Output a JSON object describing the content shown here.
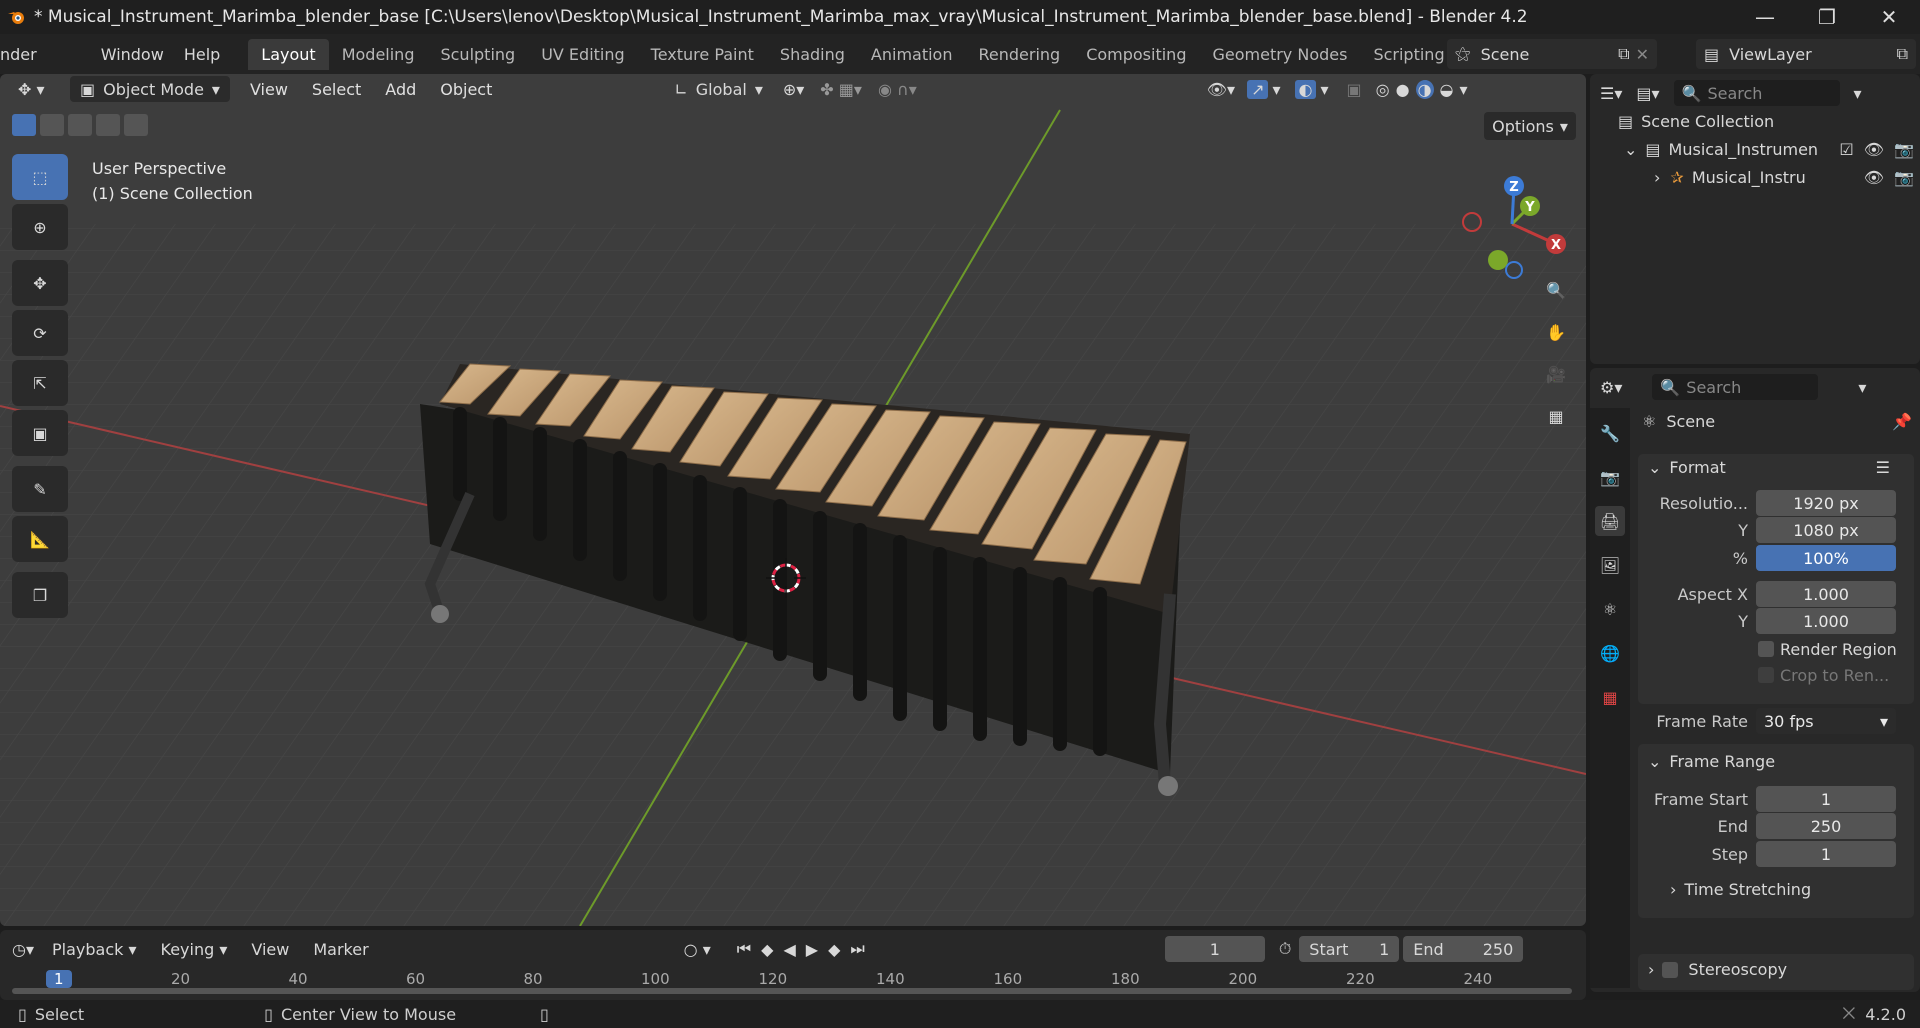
{
  "window": {
    "title": "* Musical_Instrument_Marimba_blender_base [C:\\Users\\lenov\\Desktop\\Musical_Instrument_Marimba_max_vray\\Musical_Instrument_Marimba_blender_base.blend] - Blender 4.2"
  },
  "menu": [
    "nder",
    "Window",
    "Help"
  ],
  "workspaces": [
    "Layout",
    "Modeling",
    "Sculpting",
    "UV Editing",
    "Texture Paint",
    "Shading",
    "Animation",
    "Rendering",
    "Compositing",
    "Geometry Nodes",
    "Scripting"
  ],
  "active_workspace": "Layout",
  "scene": {
    "name": "Scene",
    "view_layer": "ViewLayer"
  },
  "viewport": {
    "mode": "Object Mode",
    "menus": [
      "View",
      "Select",
      "Add",
      "Object"
    ],
    "orientation": "Global",
    "options_label": "Options",
    "info_line1": "User Perspective",
    "info_line2": "(1) Scene Collection",
    "gizmo": {
      "x": "X",
      "y": "Y",
      "z": "Z"
    }
  },
  "outliner": {
    "search_placeholder": "Search",
    "root": "Scene Collection",
    "collection": "Musical_Instrumen",
    "object": "Musical_Instru"
  },
  "properties": {
    "search_placeholder": "Search",
    "context": "Scene",
    "format": {
      "title": "Format",
      "resolution_x_label": "Resolutio...",
      "resolution_x": "1920 px",
      "resolution_y_label": "Y",
      "resolution_y": "1080 px",
      "percent_label": "%",
      "percent": "100%",
      "aspect_x_label": "Aspect X",
      "aspect_x": "1.000",
      "aspect_y_label": "Y",
      "aspect_y": "1.000",
      "render_region": "Render Region",
      "crop": "Crop to Ren...",
      "frame_rate_label": "Frame Rate",
      "frame_rate": "30 fps"
    },
    "frame_range": {
      "title": "Frame Range",
      "start_label": "Frame Start",
      "start": "1",
      "end_label": "End",
      "end": "250",
      "step_label": "Step",
      "step": "1"
    },
    "time_stretching": "Time Stretching",
    "stereoscopy": "Stereoscopy"
  },
  "timeline": {
    "menus": [
      "Playback",
      "Keying",
      "View",
      "Marker"
    ],
    "current_frame": "1",
    "start_label": "Start",
    "start": "1",
    "end_label": "End",
    "end": "250",
    "ticks": [
      "1",
      "20",
      "40",
      "60",
      "80",
      "100",
      "120",
      "140",
      "160",
      "180",
      "200",
      "220",
      "240"
    ]
  },
  "statusbar": {
    "left": "Select",
    "middle": "Center View to Mouse",
    "version": "4.2.0"
  },
  "colors": {
    "accent": "#4772b3",
    "x_axis": "#c23b3b",
    "y_axis": "#7ba82a",
    "z_axis": "#3c7bd6"
  }
}
